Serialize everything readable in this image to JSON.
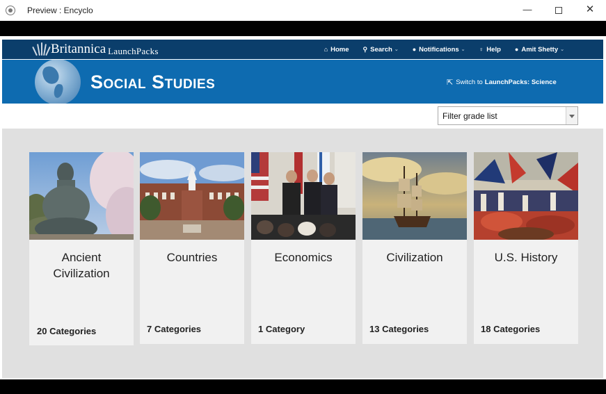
{
  "window": {
    "title": "Preview : Encyclo",
    "minimize_glyph": "—",
    "close_glyph": "✕"
  },
  "header": {
    "brand": "Britannica",
    "product": "LaunchPacks",
    "nav": [
      {
        "icon": "home-icon",
        "glyph": "⌂",
        "label": "Home",
        "has_caret": false
      },
      {
        "icon": "search-icon",
        "glyph": "⚲",
        "label": "Search",
        "has_caret": true
      },
      {
        "icon": "chat-bubble-icon",
        "glyph": "●",
        "label": "Notifications",
        "has_caret": true
      },
      {
        "icon": "lightbulb-icon",
        "glyph": "♀",
        "label": "Help",
        "has_caret": false
      },
      {
        "icon": "user-icon",
        "glyph": "●",
        "label": "Amit Shetty",
        "has_caret": true
      }
    ],
    "caret_glyph": "⌄"
  },
  "banner": {
    "title": "Social Studies",
    "switch_prefix": "Switch to",
    "switch_target": "LaunchPacks: Science",
    "switch_icon": "external-link-icon"
  },
  "filter": {
    "selected": "Filter grade list"
  },
  "cards": [
    {
      "title": "Ancient Civilization",
      "count": "20 Categories",
      "image": "buddha-statue-cherry-blossoms"
    },
    {
      "title": "Countries",
      "count": "7 Categories",
      "image": "brick-government-building"
    },
    {
      "title": "Economics",
      "count": "1 Category",
      "image": "leaders-handshake-flags"
    },
    {
      "title": "Civilization",
      "count": "13 Categories",
      "image": "tall-ship-at-sea"
    },
    {
      "title": "U.S. History",
      "count": "18 Categories",
      "image": "historical-battle-painting"
    }
  ],
  "colors": {
    "nav_bg": "#0b3e6b",
    "banner_bg": "#0e6bb0",
    "panel_bg": "#e0e0e0",
    "card_bg": "#f1f1f1"
  }
}
